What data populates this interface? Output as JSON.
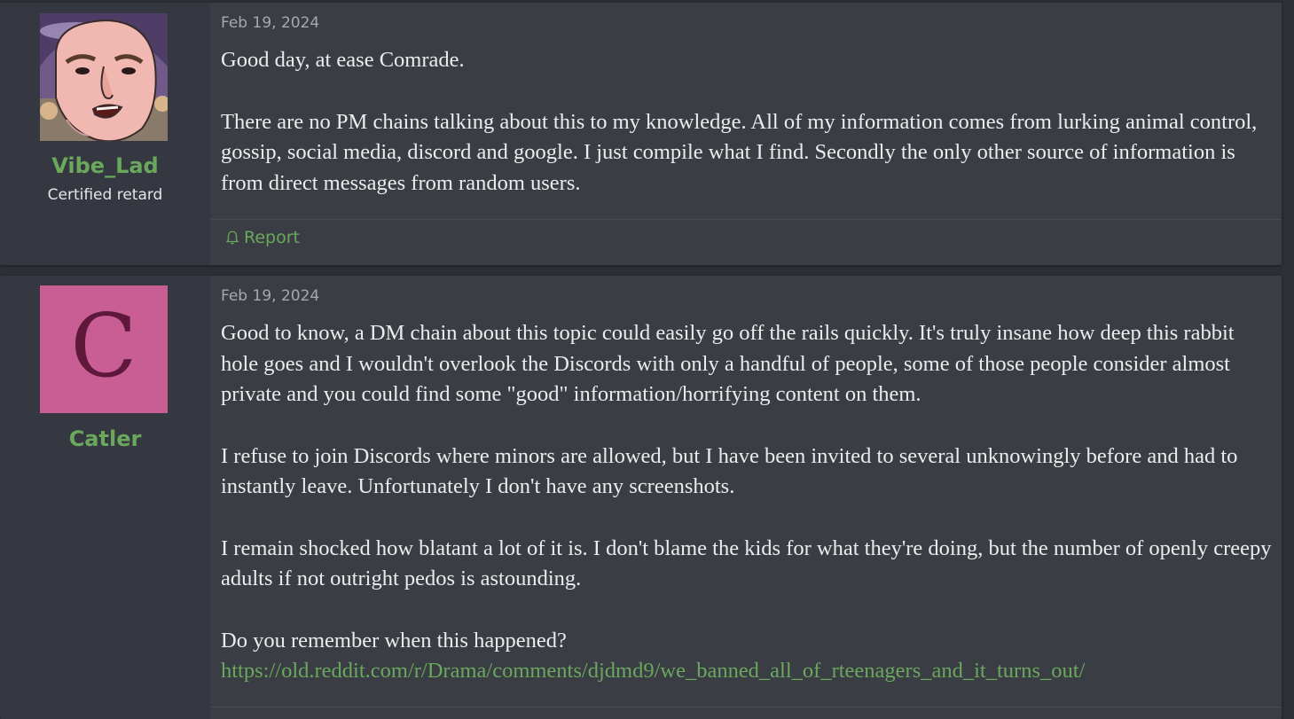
{
  "posts": [
    {
      "user": {
        "name": "Vibe_Lad",
        "title": "Certified retard",
        "avatar": "cartoon-face-avatar"
      },
      "date": "Feb 19, 2024",
      "paragraphs": [
        "Good day, at ease Comrade.",
        "There are no PM chains talking about this to my knowledge. All of my information comes from lurking animal control, gossip, social media, discord and google. I just compile what I find. Secondly the only other source of information is from direct messages from random users."
      ],
      "report_label": "Report"
    },
    {
      "user": {
        "name": "Catler",
        "avatar_letter": "C",
        "avatar_color": "#c95e95"
      },
      "date": "Feb 19, 2024",
      "paragraphs": [
        "Good to know, a DM chain about this topic could easily go off the rails quickly. It's truly insane how deep this rabbit hole goes and I wouldn't overlook the Discords with only a handful of people, some of those people consider almost private and you could find some \"good\" information/horrifying content on them.",
        "I refuse to join Discords where minors are allowed, but I have been invited to several unknowingly before and had to instantly leave. Unfortunately I don't have any screenshots.",
        "I remain shocked how blatant a lot of it is. I don't blame the kids for what they're doing, but the number of openly creepy adults if not outright pedos is astounding.",
        "Do you remember when this happened?"
      ],
      "link": "https://old.reddit.com/r/Drama/comments/djdmd9/we_banned_all_of_rteenagers_and_it_turns_out/"
    }
  ],
  "colors": {
    "accent": "#6aa85d",
    "background": "#3a3d44",
    "user_panel": "#353840"
  }
}
